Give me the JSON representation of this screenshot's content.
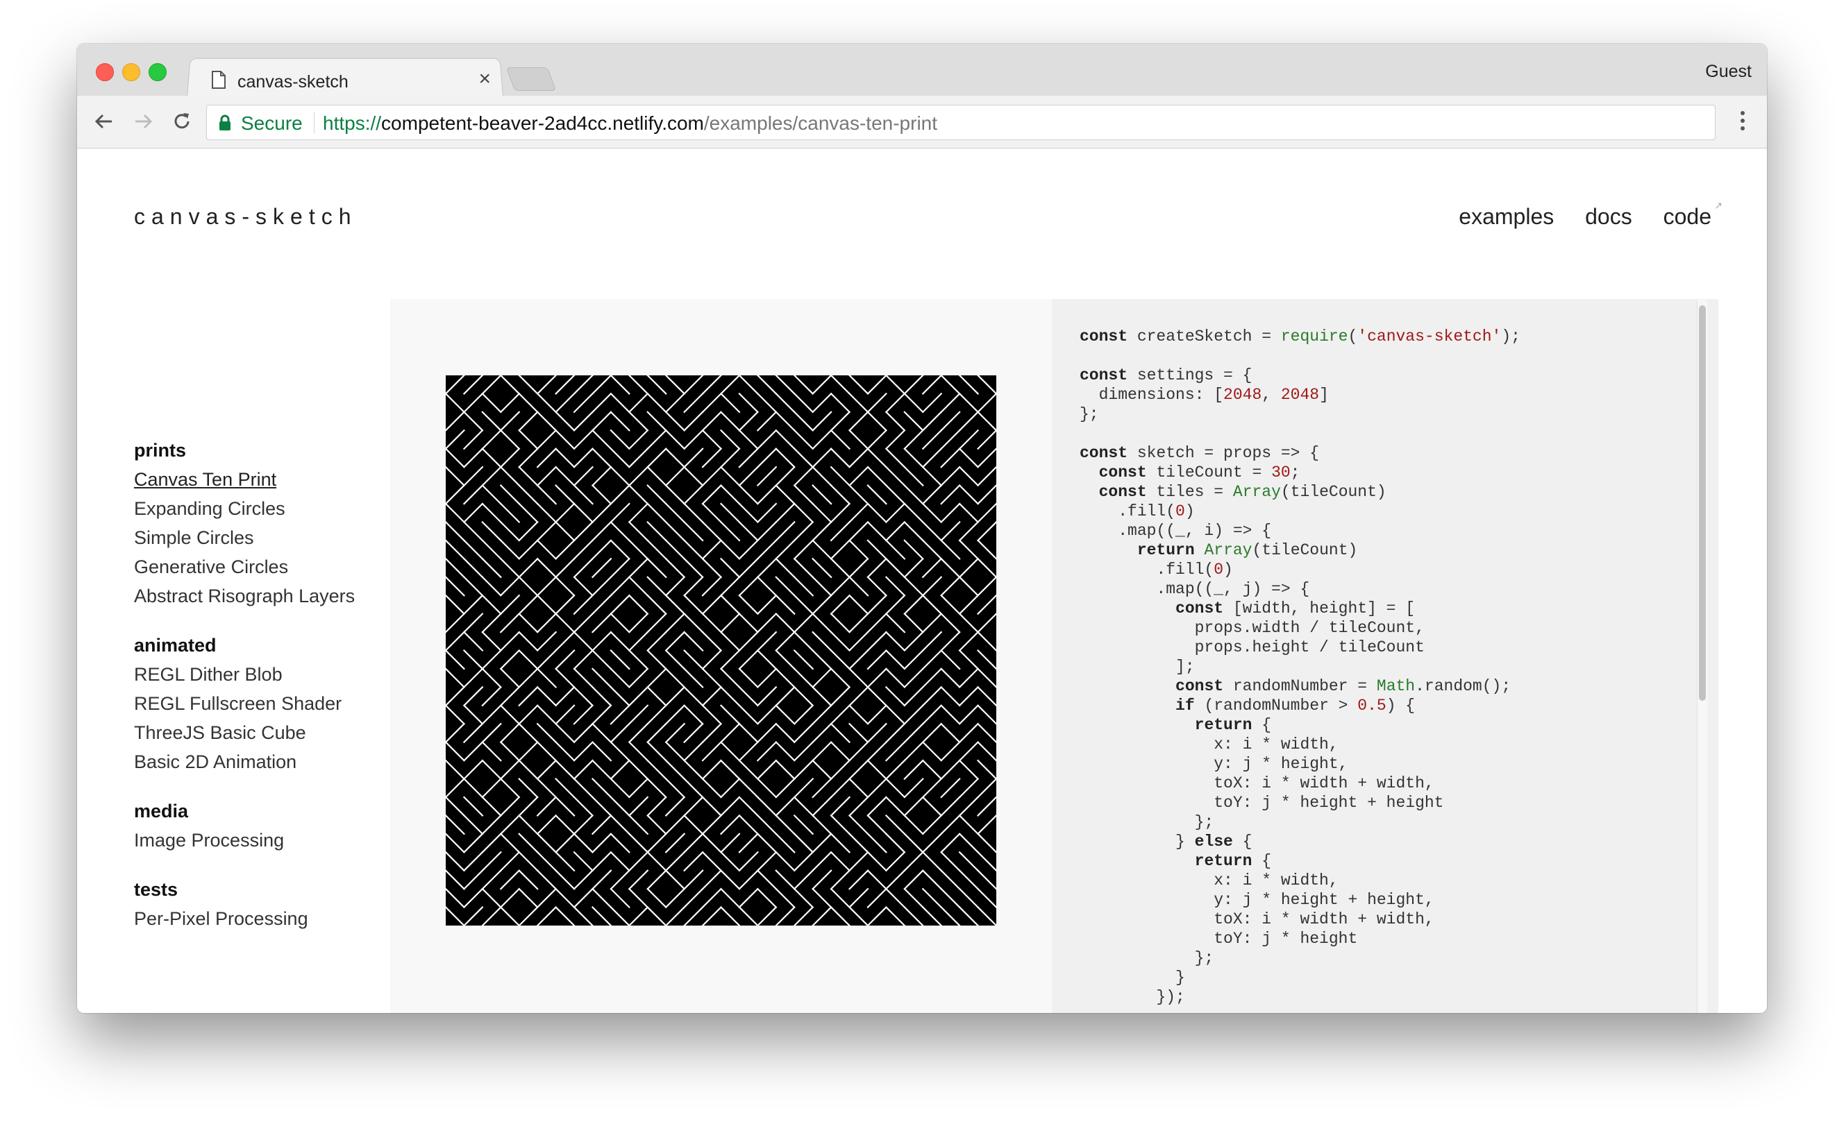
{
  "browser": {
    "tab_title": "canvas-sketch",
    "profile": "Guest",
    "secure_label": "Secure",
    "url_scheme": "https://",
    "url_host": "competent-beaver-2ad4cc.netlify.com",
    "url_path": "/examples/canvas-ten-print"
  },
  "site": {
    "logo": "canvas-sketch",
    "nav": {
      "examples": "examples",
      "docs": "docs",
      "code": "code"
    }
  },
  "sidebar": {
    "groups": [
      {
        "title": "prints",
        "items": [
          "Canvas Ten Print",
          "Expanding Circles",
          "Simple Circles",
          "Generative Circles",
          "Abstract Risograph Layers"
        ]
      },
      {
        "title": "animated",
        "items": [
          "REGL Dither Blob",
          "REGL Fullscreen Shader",
          "ThreeJS Basic Cube",
          "Basic 2D Animation"
        ]
      },
      {
        "title": "media",
        "items": [
          "Image Processing"
        ]
      },
      {
        "title": "tests",
        "items": [
          "Per-Pixel Processing"
        ]
      }
    ],
    "active_item": "Canvas Ten Print"
  },
  "code": {
    "lines": [
      [
        [
          "kw",
          "const"
        ],
        [
          "t",
          " createSketch = "
        ],
        [
          "fn",
          "require"
        ],
        [
          "t",
          "("
        ],
        [
          "str",
          "'canvas-sketch'"
        ],
        [
          "t",
          ");"
        ]
      ],
      [],
      [
        [
          "kw",
          "const"
        ],
        [
          "t",
          " settings = {"
        ]
      ],
      [
        [
          "t",
          "  dimensions: ["
        ],
        [
          "num",
          "2048"
        ],
        [
          "t",
          ", "
        ],
        [
          "num",
          "2048"
        ],
        [
          "t",
          "]"
        ]
      ],
      [
        [
          "t",
          "};"
        ]
      ],
      [],
      [
        [
          "kw",
          "const"
        ],
        [
          "t",
          " sketch = props => {"
        ]
      ],
      [
        [
          "t",
          "  "
        ],
        [
          "kw",
          "const"
        ],
        [
          "t",
          " tileCount = "
        ],
        [
          "num",
          "30"
        ],
        [
          "t",
          ";"
        ]
      ],
      [
        [
          "t",
          "  "
        ],
        [
          "kw",
          "const"
        ],
        [
          "t",
          " tiles = "
        ],
        [
          "fn",
          "Array"
        ],
        [
          "t",
          "(tileCount)"
        ]
      ],
      [
        [
          "t",
          "    .fill("
        ],
        [
          "num",
          "0"
        ],
        [
          "t",
          ")"
        ]
      ],
      [
        [
          "t",
          "    .map((_, i) => {"
        ]
      ],
      [
        [
          "t",
          "      "
        ],
        [
          "kw",
          "return"
        ],
        [
          "t",
          " "
        ],
        [
          "fn",
          "Array"
        ],
        [
          "t",
          "(tileCount)"
        ]
      ],
      [
        [
          "t",
          "        .fill("
        ],
        [
          "num",
          "0"
        ],
        [
          "t",
          ")"
        ]
      ],
      [
        [
          "t",
          "        .map((_, j) => {"
        ]
      ],
      [
        [
          "t",
          "          "
        ],
        [
          "kw",
          "const"
        ],
        [
          "t",
          " [width, height] = ["
        ]
      ],
      [
        [
          "t",
          "            props.width / tileCount,"
        ]
      ],
      [
        [
          "t",
          "            props.height / tileCount"
        ]
      ],
      [
        [
          "t",
          "          ];"
        ]
      ],
      [
        [
          "t",
          "          "
        ],
        [
          "kw",
          "const"
        ],
        [
          "t",
          " randomNumber = "
        ],
        [
          "fn",
          "Math"
        ],
        [
          "t",
          ".random();"
        ]
      ],
      [
        [
          "t",
          "          "
        ],
        [
          "kw",
          "if"
        ],
        [
          "t",
          " (randomNumber > "
        ],
        [
          "num",
          "0.5"
        ],
        [
          "t",
          ") {"
        ]
      ],
      [
        [
          "t",
          "            "
        ],
        [
          "kw",
          "return"
        ],
        [
          "t",
          " {"
        ]
      ],
      [
        [
          "t",
          "              x: i * width,"
        ]
      ],
      [
        [
          "t",
          "              y: j * height,"
        ]
      ],
      [
        [
          "t",
          "              toX: i * width + width,"
        ]
      ],
      [
        [
          "t",
          "              toY: j * height + height"
        ]
      ],
      [
        [
          "t",
          "            };"
        ]
      ],
      [
        [
          "t",
          "          } "
        ],
        [
          "kw",
          "else"
        ],
        [
          "t",
          " {"
        ]
      ],
      [
        [
          "t",
          "            "
        ],
        [
          "kw",
          "return"
        ],
        [
          "t",
          " {"
        ]
      ],
      [
        [
          "t",
          "              x: i * width,"
        ]
      ],
      [
        [
          "t",
          "              y: j * height + height,"
        ]
      ],
      [
        [
          "t",
          "              toX: i * width + width,"
        ]
      ],
      [
        [
          "t",
          "              toY: j * height"
        ]
      ],
      [
        [
          "t",
          "            };"
        ]
      ],
      [
        [
          "t",
          "          }"
        ]
      ],
      [
        [
          "t",
          "        });"
        ]
      ]
    ]
  },
  "colors": {
    "secure_green": "#0b8043",
    "keyword": "#222222",
    "function": "#2a7a2a",
    "string": "#a01818"
  },
  "icons": [
    "page-icon",
    "close-icon",
    "back-arrow-icon",
    "forward-arrow-icon",
    "reload-icon",
    "lock-icon",
    "more-vert-icon",
    "external-link-icon"
  ]
}
